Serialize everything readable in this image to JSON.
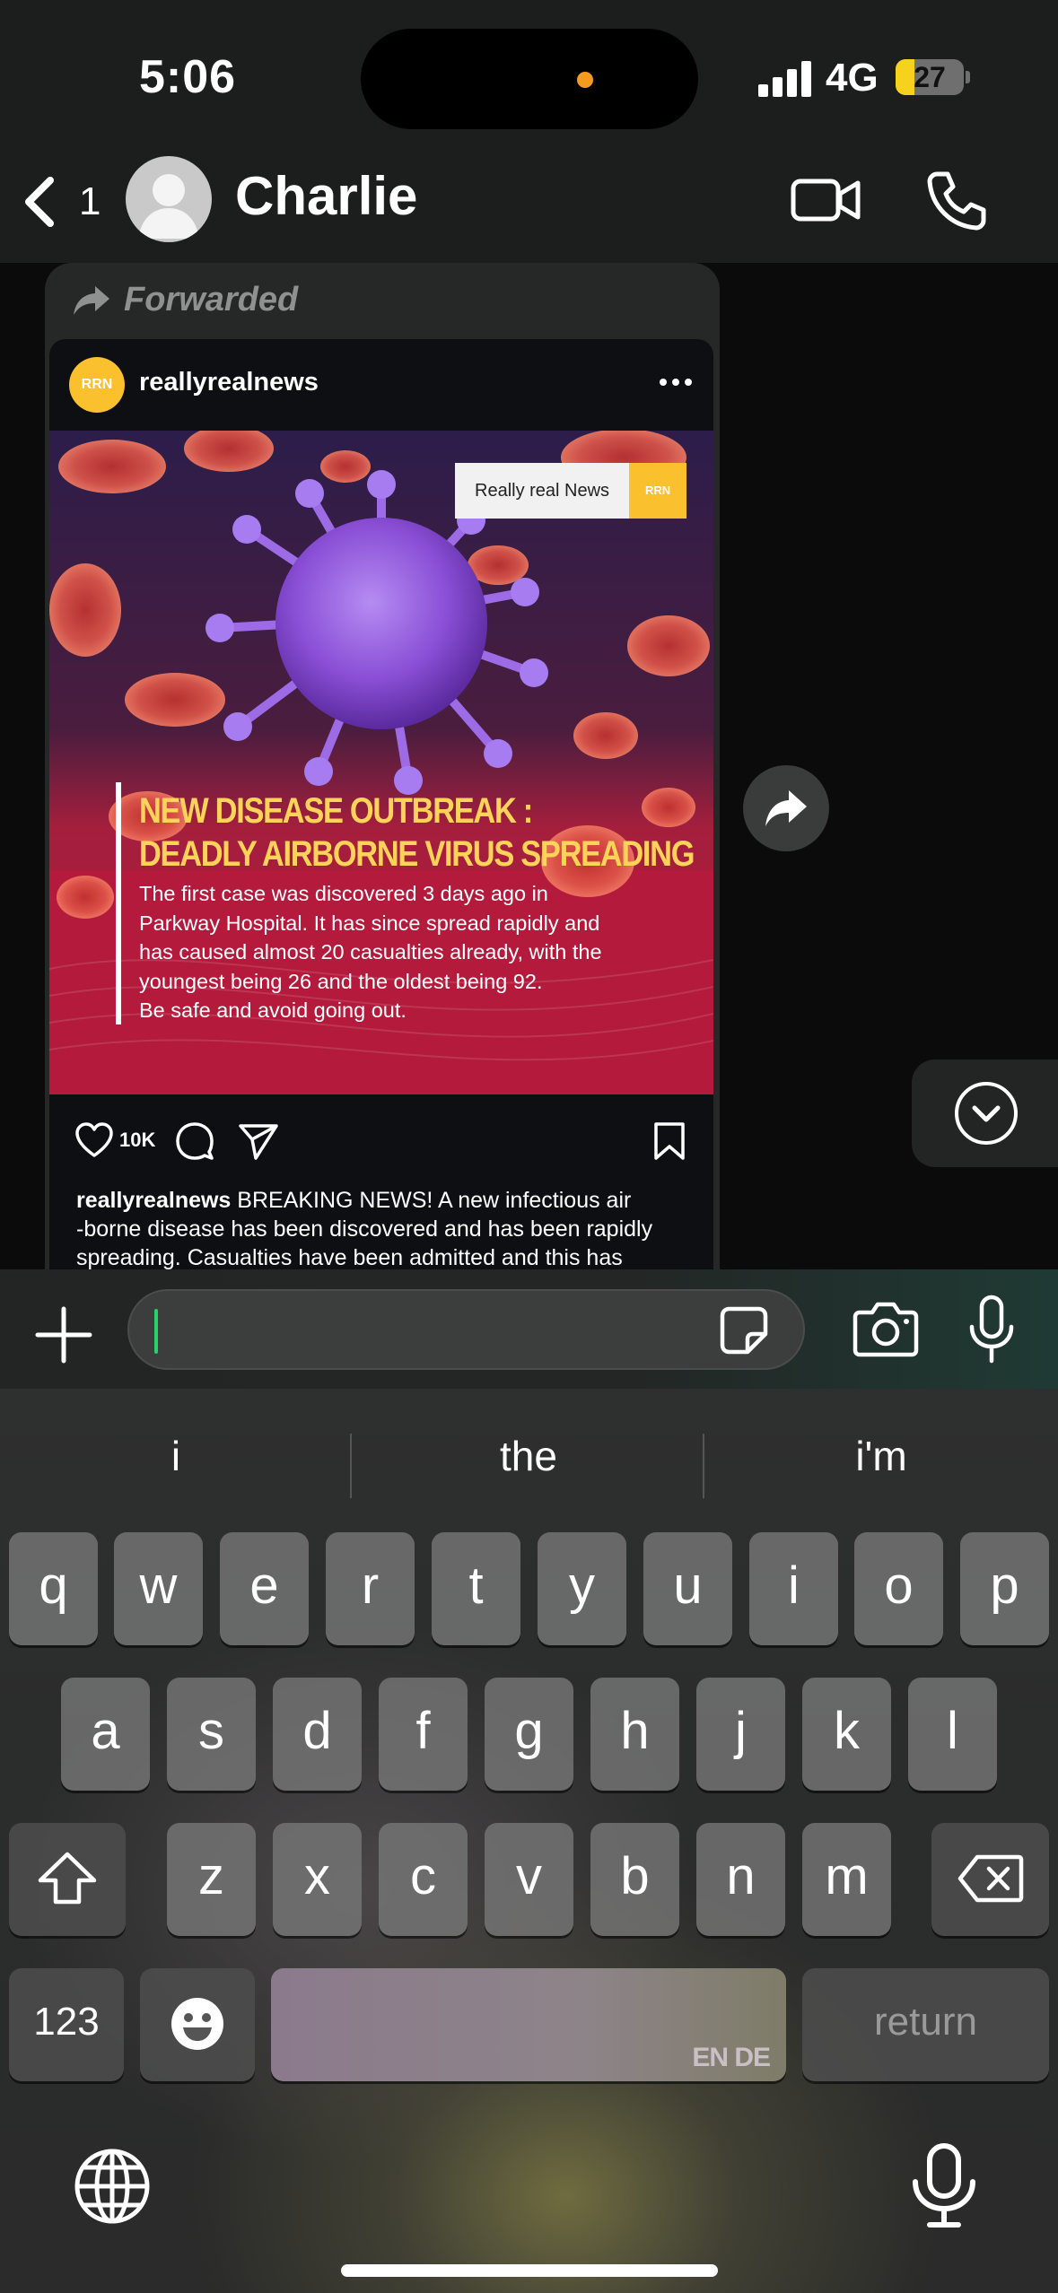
{
  "status_bar": {
    "time": "5:06",
    "network": "4G",
    "battery": "27",
    "battery_level": 0.27,
    "battery_color": "#f7d21d"
  },
  "header": {
    "unread_count": "1",
    "contact_name": "Charlie"
  },
  "message": {
    "forwarded_label": "Forwarded",
    "post": {
      "avatar_text": "RRN",
      "username": "reallyrealnews",
      "brand_name": "Really real News",
      "brand_badge": "RRN",
      "headline_line1": "NEW DISEASE OUTBREAK :",
      "headline_line2": "DEADLY AIRBORNE VIRUS SPREADING",
      "article_lines": [
        "The first case was discovered 3 days ago in",
        "Parkway Hospital. It has since spread rapidly and",
        "has caused almost 20 casualties already, with the",
        "youngest being 26 and the oldest being 92.",
        "Be safe and avoid going out."
      ],
      "likes": "10K",
      "caption_user": "reallyrealnews",
      "caption_lines": [
        " BREAKING NEWS! A new infectious air",
        "-borne disease has been discovered and has been rapidly",
        "spreading. Casualties have been admitted and this has"
      ]
    }
  },
  "compose": {
    "placeholder": ""
  },
  "keyboard": {
    "suggestions": [
      "i",
      "the",
      "i'm"
    ],
    "row1": [
      "q",
      "w",
      "e",
      "r",
      "t",
      "y",
      "u",
      "i",
      "o",
      "p"
    ],
    "row2": [
      "a",
      "s",
      "d",
      "f",
      "g",
      "h",
      "j",
      "k",
      "l"
    ],
    "row3": [
      "z",
      "x",
      "c",
      "v",
      "b",
      "n",
      "m"
    ],
    "numbers_label": "123",
    "space_lang": "EN DE",
    "return_label": "return"
  },
  "colors": {
    "accent": "#25d366",
    "headline": "#ffd35a",
    "brand_yellow": "#fbc02d"
  }
}
